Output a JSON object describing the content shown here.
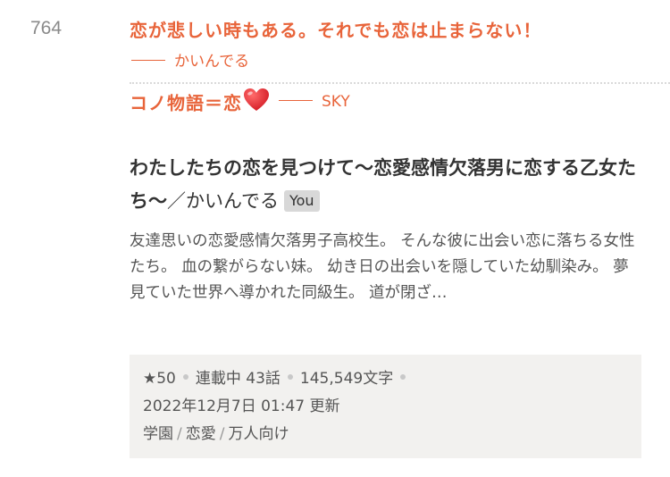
{
  "rank": "764",
  "catchphrases": [
    {
      "text": "恋が悲しい時もある。それでも恋は止まらない！",
      "author": "かいんでる"
    },
    {
      "text": "コノ物語＝恋",
      "emoji": "heart-emoji",
      "author": "SKY"
    }
  ],
  "work": {
    "title": "わたしたちの恋を見つけて〜恋愛感情欠落男に恋する乙女たち〜",
    "author_sep": "／",
    "author": "かいんでる",
    "you_badge": "You",
    "description": "友達思いの恋愛感情欠落男子高校生。 そんな彼に出会い恋に落ちる女性たち。 血の繋がらない妹。 幼き日の出会いを隠していた幼馴染み。 夢見ていた世界へ導かれた同級生。 道が閉ざ…"
  },
  "meta": {
    "stars": "★50",
    "status": "連載中 43話",
    "chars": "145,549文字",
    "updated": "2022年12月7日 01:47 更新",
    "tags": [
      "学園",
      "恋愛",
      "万人向け"
    ],
    "tag_sep": "/"
  },
  "colors": {
    "accent": "#e8643a",
    "text": "#333333",
    "muted": "#8a8a8a",
    "meta_bg": "#f2f1ef",
    "badge_bg": "#d8d8d8",
    "heart": "#e0202a"
  }
}
